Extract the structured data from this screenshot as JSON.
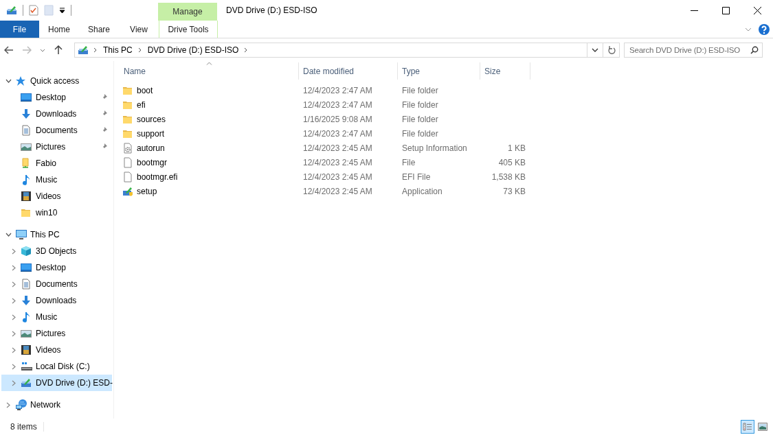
{
  "window": {
    "title": "DVD Drive (D:) ESD-ISO",
    "context_group": "Manage"
  },
  "ribbon": {
    "tabs": [
      {
        "label": "File",
        "kind": "file"
      },
      {
        "label": "Home",
        "kind": "tab"
      },
      {
        "label": "Share",
        "kind": "tab"
      },
      {
        "label": "View",
        "kind": "tab"
      },
      {
        "label": "Drive Tools",
        "kind": "context"
      }
    ]
  },
  "address": {
    "crumbs": [
      "This PC",
      "DVD Drive (D:) ESD-ISO"
    ]
  },
  "search": {
    "placeholder": "Search DVD Drive (D:) ESD-ISO"
  },
  "sidebar": {
    "items": [
      {
        "label": "Quick access",
        "kind": "quick-access",
        "expanded": true,
        "selected": false,
        "children": [
          {
            "label": "Desktop",
            "kind": "desktop",
            "pinned": true,
            "selected": false
          },
          {
            "label": "Downloads",
            "kind": "downloads",
            "pinned": true,
            "selected": false
          },
          {
            "label": "Documents",
            "kind": "documents",
            "pinned": true,
            "selected": false
          },
          {
            "label": "Pictures",
            "kind": "pictures",
            "pinned": true,
            "selected": false
          },
          {
            "label": "Fabio",
            "kind": "user",
            "pinned": false,
            "selected": false
          },
          {
            "label": "Music",
            "kind": "music",
            "pinned": false,
            "selected": false
          },
          {
            "label": "Videos",
            "kind": "videos",
            "pinned": false,
            "selected": false
          },
          {
            "label": "win10",
            "kind": "folder",
            "pinned": false,
            "selected": false
          }
        ]
      },
      {
        "label": "This PC",
        "kind": "pc",
        "expanded": true,
        "selected": false,
        "children": [
          {
            "label": "3D Objects",
            "kind": "objects",
            "expanded": false,
            "selected": false
          },
          {
            "label": "Desktop",
            "kind": "desktop",
            "expanded": false,
            "selected": false
          },
          {
            "label": "Documents",
            "kind": "documents",
            "expanded": false,
            "selected": false
          },
          {
            "label": "Downloads",
            "kind": "downloads",
            "expanded": false,
            "selected": false
          },
          {
            "label": "Music",
            "kind": "music",
            "expanded": false,
            "selected": false
          },
          {
            "label": "Pictures",
            "kind": "pictures",
            "expanded": false,
            "selected": false
          },
          {
            "label": "Videos",
            "kind": "videos",
            "expanded": false,
            "selected": false
          },
          {
            "label": "Local Disk (C:)",
            "kind": "disk",
            "expanded": false,
            "selected": false
          },
          {
            "label": "DVD Drive (D:) ESD-",
            "kind": "dvd",
            "expanded": false,
            "selected": true
          }
        ]
      },
      {
        "label": "Network",
        "kind": "network",
        "expanded": false,
        "selected": false
      }
    ]
  },
  "table": {
    "columns": [
      {
        "label": "Name",
        "sorted": true
      },
      {
        "label": "Date modified",
        "sorted": false
      },
      {
        "label": "Type",
        "sorted": false
      },
      {
        "label": "Size",
        "sorted": false
      }
    ],
    "rows": [
      {
        "name": "boot",
        "date": "12/4/2023 2:47 AM",
        "type": "File folder",
        "kind": "folder"
      },
      {
        "name": "efi",
        "date": "12/4/2023 2:47 AM",
        "type": "File folder",
        "kind": "folder"
      },
      {
        "name": "sources",
        "date": "1/16/2025 9:08 AM",
        "type": "File folder",
        "kind": "folder"
      },
      {
        "name": "support",
        "date": "12/4/2023 2:47 AM",
        "type": "File folder",
        "kind": "folder"
      },
      {
        "name": "autorun",
        "date": "12/4/2023 2:45 AM",
        "type": "Setup Information",
        "size": "1 KB",
        "kind": "settings"
      },
      {
        "name": "bootmgr",
        "date": "12/4/2023 2:45 AM",
        "type": "File",
        "size": "405 KB",
        "kind": "file"
      },
      {
        "name": "bootmgr.efi",
        "date": "12/4/2023 2:45 AM",
        "type": "EFI File",
        "size": "1,538 KB",
        "kind": "file"
      },
      {
        "name": "setup",
        "date": "12/4/2023 2:45 AM",
        "type": "Application",
        "size": "73 KB",
        "kind": "setup"
      }
    ]
  },
  "status_bar": {
    "count": "8 items",
    "views": [
      {
        "kind": "details",
        "selected": true
      },
      {
        "kind": "large-icons",
        "selected": false
      }
    ]
  }
}
